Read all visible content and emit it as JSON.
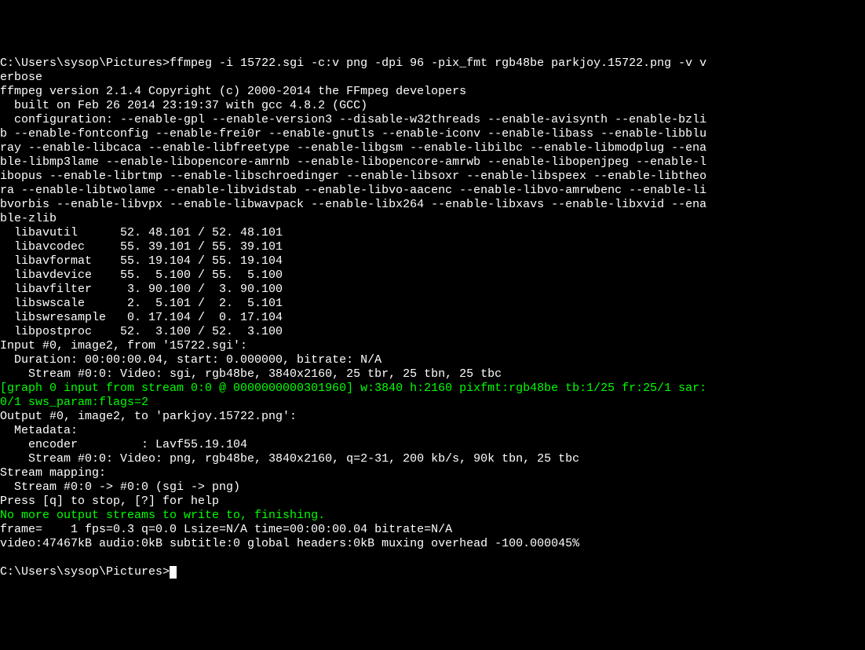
{
  "prompt1": "C:\\Users\\sysop\\Pictures>",
  "cmd1": "ffmpeg -i 15722.sgi -c:v png -dpi 96 -pix_fmt rgb48be parkjoy.15722.png -v v",
  "cmd1b": "erbose",
  "l1": "ffmpeg version 2.1.4 Copyright (c) 2000-2014 the FFmpeg developers",
  "l2": "  built on Feb 26 2014 23:19:37 with gcc 4.8.2 (GCC)",
  "l3": "  configuration: --enable-gpl --enable-version3 --disable-w32threads --enable-avisynth --enable-bzli",
  "l4": "b --enable-fontconfig --enable-frei0r --enable-gnutls --enable-iconv --enable-libass --enable-libblu",
  "l5": "ray --enable-libcaca --enable-libfreetype --enable-libgsm --enable-libilbc --enable-libmodplug --ena",
  "l6": "ble-libmp3lame --enable-libopencore-amrnb --enable-libopencore-amrwb --enable-libopenjpeg --enable-l",
  "l7": "ibopus --enable-librtmp --enable-libschroedinger --enable-libsoxr --enable-libspeex --enable-libtheo",
  "l8": "ra --enable-libtwolame --enable-libvidstab --enable-libvo-aacenc --enable-libvo-amrwbenc --enable-li",
  "l9": "bvorbis --enable-libvpx --enable-libwavpack --enable-libx264 --enable-libxavs --enable-libxvid --ena",
  "l10": "ble-zlib",
  "l11": "  libavutil      52. 48.101 / 52. 48.101",
  "l12": "  libavcodec     55. 39.101 / 55. 39.101",
  "l13": "  libavformat    55. 19.104 / 55. 19.104",
  "l14": "  libavdevice    55.  5.100 / 55.  5.100",
  "l15": "  libavfilter     3. 90.100 /  3. 90.100",
  "l16": "  libswscale      2.  5.101 /  2.  5.101",
  "l17": "  libswresample   0. 17.104 /  0. 17.104",
  "l18": "  libpostproc    52.  3.100 / 52.  3.100",
  "l19": "Input #0, image2, from '15722.sgi':",
  "l20": "  Duration: 00:00:00.04, start: 0.000000, bitrate: N/A",
  "l21": "    Stream #0:0: Video: sgi, rgb48be, 3840x2160, 25 tbr, 25 tbn, 25 tbc",
  "g1": "[graph 0 input from stream 0:0 @ 0000000000301960] w:3840 h:2160 pixfmt:rgb48be tb:1/25 fr:25/1 sar:",
  "g2": "0/1 sws_param:flags=2",
  "l22": "Output #0, image2, to 'parkjoy.15722.png':",
  "l23": "  Metadata:",
  "l24": "    encoder         : Lavf55.19.104",
  "l25": "    Stream #0:0: Video: png, rgb48be, 3840x2160, q=2-31, 200 kb/s, 90k tbn, 25 tbc",
  "l26": "Stream mapping:",
  "l27": "  Stream #0:0 -> #0:0 (sgi -> png)",
  "l28": "Press [q] to stop, [?] for help",
  "g3": "No more output streams to write to, finishing.",
  "l29": "frame=    1 fps=0.3 q=0.0 Lsize=N/A time=00:00:00.04 bitrate=N/A",
  "l30": "video:47467kB audio:0kB subtitle:0 global headers:0kB muxing overhead -100.000045%",
  "blank": "",
  "prompt2": "C:\\Users\\sysop\\Pictures>"
}
